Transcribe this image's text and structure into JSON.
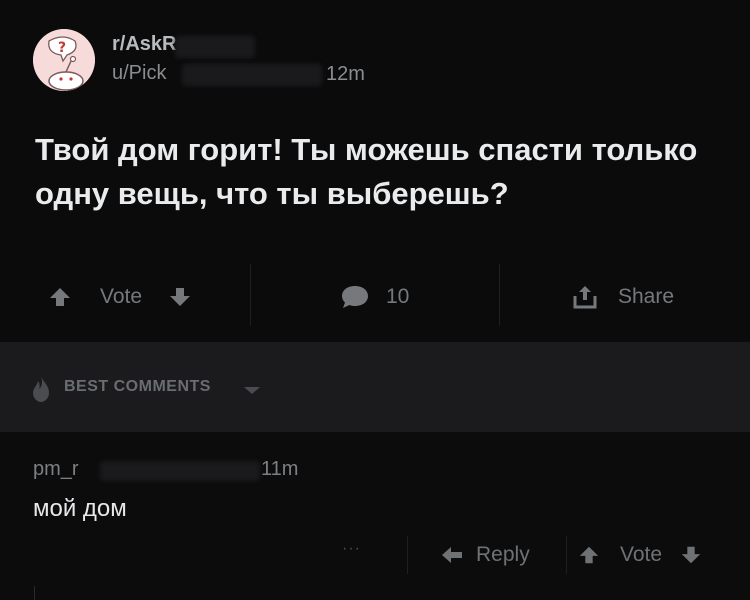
{
  "post": {
    "subreddit": "r/AskR",
    "username": "u/Pick",
    "time": "12m",
    "title": "Твой дом горит! Ты можешь спасти только одну вещь, что ты выберешь?",
    "vote_label": "Vote",
    "comments_count": "10",
    "share_label": "Share"
  },
  "best_comments": {
    "label": "BEST COMMENTS"
  },
  "comment": {
    "username": "pm_r",
    "time": "11m",
    "body": "мой дом",
    "more_label": "···",
    "reply_label": "Reply",
    "vote_label": "Vote"
  },
  "colors": {
    "background": "#0b0b0c",
    "panel": "#1b1b1d",
    "text_primary": "#e9ebed",
    "text_muted": "#7d8083",
    "avatar_bg": "#f6d7d7"
  },
  "icons": [
    "snoo-question-avatar",
    "upvote-icon",
    "downvote-icon",
    "comment-bubble-icon",
    "share-icon",
    "flame-icon",
    "chevron-down-icon",
    "more-icon",
    "reply-icon"
  ]
}
